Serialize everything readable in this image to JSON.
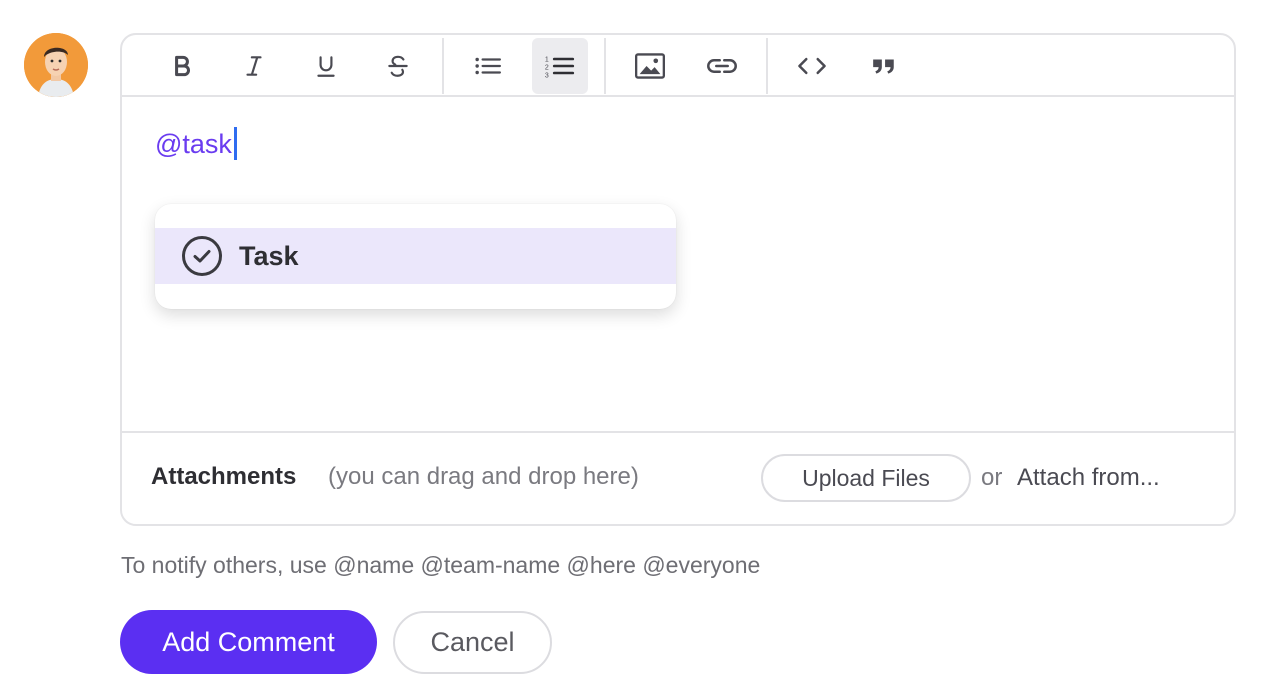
{
  "user": {
    "avatar_icon": "user-avatar"
  },
  "toolbar": {
    "buttons": [
      {
        "name": "bold",
        "icon": "bold-icon"
      },
      {
        "name": "italic",
        "icon": "italic-icon"
      },
      {
        "name": "underline",
        "icon": "underline-icon"
      },
      {
        "name": "strikethrough",
        "icon": "strikethrough-icon"
      },
      {
        "name": "bulleted-list",
        "icon": "bulleted-list-icon"
      },
      {
        "name": "numbered-list",
        "icon": "numbered-list-icon",
        "active": true
      },
      {
        "name": "image",
        "icon": "image-icon"
      },
      {
        "name": "link",
        "icon": "link-icon"
      },
      {
        "name": "code",
        "icon": "code-icon"
      },
      {
        "name": "quote",
        "icon": "quote-icon"
      }
    ]
  },
  "editor": {
    "text": "@task"
  },
  "suggestions": {
    "items": [
      {
        "label": "Task",
        "icon": "check-circle-icon"
      }
    ]
  },
  "attachments": {
    "title": "Attachments",
    "hint": "(you can drag and drop here)",
    "upload_label": "Upload Files",
    "or_text": "or",
    "attach_from_label": "Attach from..."
  },
  "notify_text": "To notify others, use @name @team-name @here @everyone",
  "actions": {
    "add_comment_label": "Add Comment",
    "cancel_label": "Cancel"
  },
  "colors": {
    "accent": "#5b2ff2",
    "mention": "#6a3cf0",
    "highlight": "#ebe7fb",
    "caret": "#2f6cf0"
  }
}
